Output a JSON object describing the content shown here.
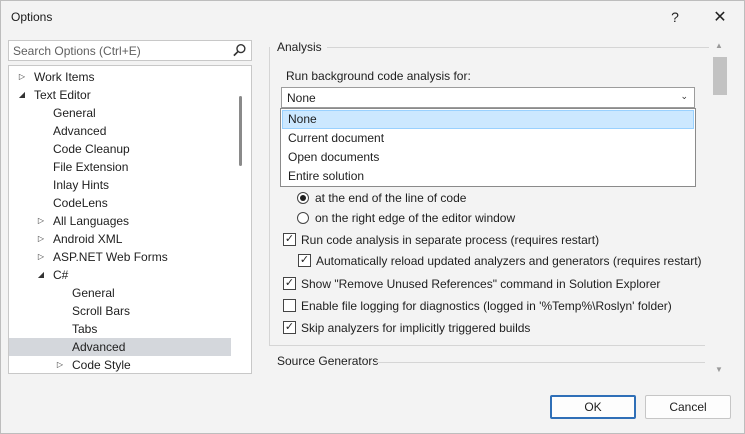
{
  "window": {
    "title": "Options",
    "help_glyph": "?",
    "close_glyph": "✕"
  },
  "search": {
    "placeholder": "Search Options (Ctrl+E)"
  },
  "tree": {
    "items": [
      {
        "label": "Work Items",
        "indent": 0,
        "arrow": "▷"
      },
      {
        "label": "Text Editor",
        "indent": 0,
        "arrow": "◢"
      },
      {
        "label": "General",
        "indent": 1,
        "arrow": ""
      },
      {
        "label": "Advanced",
        "indent": 1,
        "arrow": ""
      },
      {
        "label": "Code Cleanup",
        "indent": 1,
        "arrow": ""
      },
      {
        "label": "File Extension",
        "indent": 1,
        "arrow": ""
      },
      {
        "label": "Inlay Hints",
        "indent": 1,
        "arrow": ""
      },
      {
        "label": "CodeLens",
        "indent": 1,
        "arrow": ""
      },
      {
        "label": "All Languages",
        "indent": 1,
        "arrow": "▷"
      },
      {
        "label": "Android XML",
        "indent": 1,
        "arrow": "▷"
      },
      {
        "label": "ASP.NET Web Forms",
        "indent": 1,
        "arrow": "▷"
      },
      {
        "label": "C#",
        "indent": 1,
        "arrow": "◢"
      },
      {
        "label": "General",
        "indent": 2,
        "arrow": ""
      },
      {
        "label": "Scroll Bars",
        "indent": 2,
        "arrow": ""
      },
      {
        "label": "Tabs",
        "indent": 2,
        "arrow": ""
      },
      {
        "label": "Advanced",
        "indent": 2,
        "arrow": "",
        "selected": true
      },
      {
        "label": "Code Style",
        "indent": 2,
        "arrow": "▷"
      }
    ]
  },
  "analysis": {
    "group_title": "Analysis",
    "run_label": "Run background code analysis for:",
    "run_value": "None",
    "run_options": [
      "None",
      "Current document",
      "Open documents",
      "Entire solution"
    ],
    "radio_end_of_line": "at the end of the line of code",
    "radio_right_edge": "on the right edge of the editor window",
    "chk_separate_process": "Run code analysis in separate process (requires restart)",
    "chk_auto_reload": "Automatically reload updated analyzers and generators (requires restart)",
    "chk_remove_unused": "Show \"Remove Unused References\" command in Solution Explorer",
    "chk_file_logging": "Enable file logging for diagnostics (logged in '%Temp%\\Roslyn' folder)",
    "chk_skip_analyzers": "Skip analyzers for implicitly triggered builds",
    "states": {
      "radio_end_of_line": true,
      "radio_right_edge": false,
      "chk_separate_process": true,
      "chk_auto_reload": true,
      "chk_remove_unused": true,
      "chk_file_logging": false,
      "chk_skip_analyzers": true
    }
  },
  "source_generators": {
    "group_title": "Source Generators"
  },
  "buttons": {
    "ok": "OK",
    "cancel": "Cancel"
  },
  "glyphs": {
    "check": "✓",
    "chevron_down": "⌄",
    "scroll_up": "▲",
    "scroll_down": "▼"
  }
}
